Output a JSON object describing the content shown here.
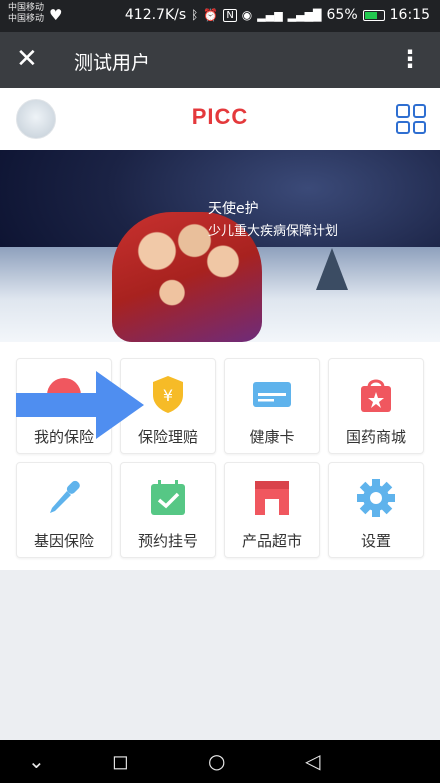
{
  "status_bar": {
    "carrier_line1": "中国移动",
    "carrier_line2": "中国移动",
    "speed": "412.7K/s",
    "battery_percent": "65%",
    "battery_level": 0.65,
    "time": "16:15"
  },
  "title_bar": {
    "title": "测试用户",
    "close_icon": "close-icon",
    "more_icon": "more-vertical-icon"
  },
  "app_header": {
    "logo_text": "PICC",
    "grid_icon": "grid-menu-icon",
    "accent_color": "#e4393c",
    "icon_color": "#2f6fd1"
  },
  "banner": {
    "line1": "天使e护",
    "line2": "少儿重大疾病保障计划"
  },
  "menu": {
    "items": [
      {
        "label": "我的保险",
        "icon": "umbrella-icon",
        "color": "#f0575f"
      },
      {
        "label": "保险理赔",
        "icon": "shield-yen-icon",
        "color": "#f6bb27"
      },
      {
        "label": "健康卡",
        "icon": "card-icon",
        "color": "#5fb3ec"
      },
      {
        "label": "国药商城",
        "icon": "shopping-bag-icon",
        "color": "#f0575f"
      },
      {
        "label": "基因保险",
        "icon": "dropper-icon",
        "color": "#5fb3ec"
      },
      {
        "label": "预约挂号",
        "icon": "calendar-check-icon",
        "color": "#56c785"
      },
      {
        "label": "产品超市",
        "icon": "store-icon",
        "color": "#f0575f"
      },
      {
        "label": "设置",
        "icon": "gear-icon",
        "color": "#5fb3ec"
      }
    ]
  },
  "overlay": {
    "arrow_color": "#4f8ef0"
  },
  "nav_bar": {
    "back": "chevron-down-icon",
    "recents": "square-icon",
    "home": "circle-icon",
    "return": "triangle-back-icon"
  }
}
